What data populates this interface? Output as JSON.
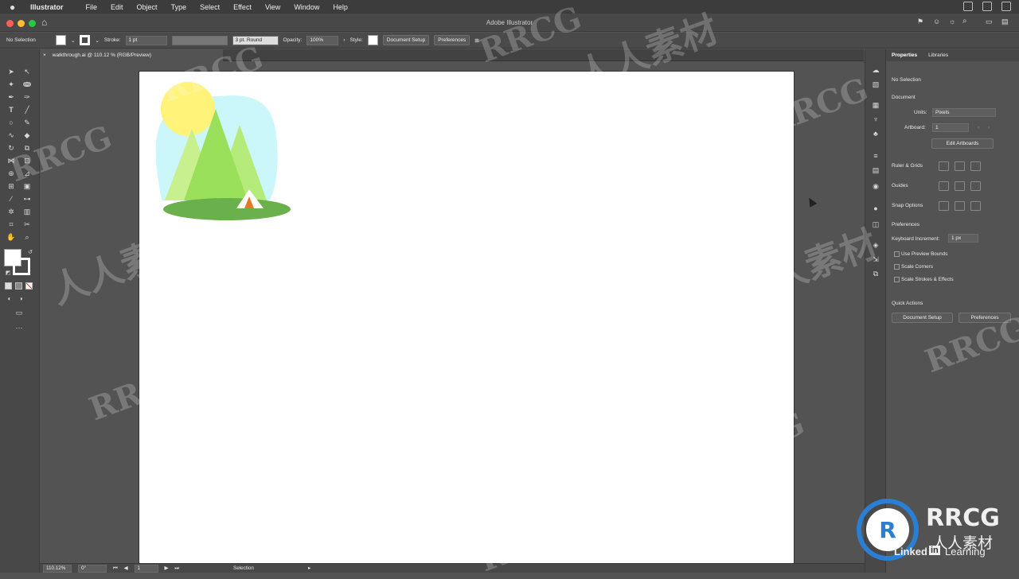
{
  "menubar": {
    "app": "Illustrator",
    "items": [
      "File",
      "Edit",
      "Object",
      "Type",
      "Select",
      "Effect",
      "View",
      "Window",
      "Help"
    ]
  },
  "window": {
    "title": "Adobe Illustrator"
  },
  "control": {
    "selection": "No Selection",
    "stroke_label": "Stroke:",
    "stroke_value": "1 pt",
    "brush": "3 pt. Round",
    "opacity_label": "Opacity:",
    "opacity_value": "100%",
    "style_label": "Style:",
    "doc_setup": "Document Setup",
    "preferences": "Preferences"
  },
  "tab": {
    "name": "walkthrough.ai @ 110.12 % (RGB/Preview)"
  },
  "panel": {
    "tabs": [
      "Properties",
      "Libraries"
    ],
    "no_selection": "No Selection",
    "document": "Document",
    "units_label": "Units:",
    "units_value": "Pixels",
    "artboard_label": "Artboard:",
    "artboard_value": "1",
    "edit_artboards": "Edit Artboards",
    "ruler_grids": "Ruler & Grids",
    "guides": "Guides",
    "snap_options": "Snap Options",
    "preferences": "Preferences",
    "kb_increment_label": "Keyboard Increment:",
    "kb_increment_value": "1 px",
    "use_preview_bounds": "Use Preview Bounds",
    "scale_corners": "Scale Corners",
    "scale_strokes": "Scale Strokes & Effects",
    "quick_actions": "Quick Actions",
    "doc_setup_btn": "Document Setup",
    "prefs_btn": "Preferences"
  },
  "status": {
    "zoom": "110.12%",
    "rotation": "0°",
    "artboard": "1",
    "tool": "Selection"
  },
  "watermark": {
    "latin": "RRCG",
    "cjk": "人人素材",
    "brand": "RRCG",
    "brand_sub": "人人素材",
    "linkedin": "Linked",
    "linkedin_in": "in",
    "learning": "Learning"
  },
  "colors": {
    "sky": "#ccf7fa",
    "sun": "#fff37a",
    "tree_light": "#c8f08f",
    "tree_mid": "#9ae05a",
    "ground": "#6ab04c",
    "tent": "#e07a2c"
  }
}
